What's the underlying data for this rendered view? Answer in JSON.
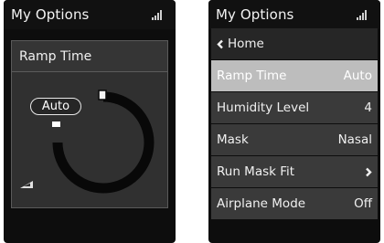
{
  "left_screen": {
    "status_title": "My Options",
    "panel_title": "Ramp Time",
    "value_label": "Auto"
  },
  "right_screen": {
    "status_title": "My Options",
    "back_label": "Home",
    "items": [
      {
        "label": "Ramp Time",
        "value": "Auto",
        "selected": true
      },
      {
        "label": "Humidity Level",
        "value": "4"
      },
      {
        "label": "Mask",
        "value": "Nasal"
      },
      {
        "label": "Run Mask Fit",
        "value_icon": "chevron-right-icon"
      },
      {
        "label": "Airplane Mode",
        "value": "Off"
      }
    ]
  },
  "icons": {
    "status": "signal-strength-icon",
    "back": "chevron-left-icon",
    "ramp": "ramp-up-icon"
  },
  "colors": {
    "background": "#0d0d0d",
    "panel": "#303030",
    "menu_item": "#3a3a3a",
    "selected_item": "#bdbdbd",
    "ring_track": "#080808"
  }
}
